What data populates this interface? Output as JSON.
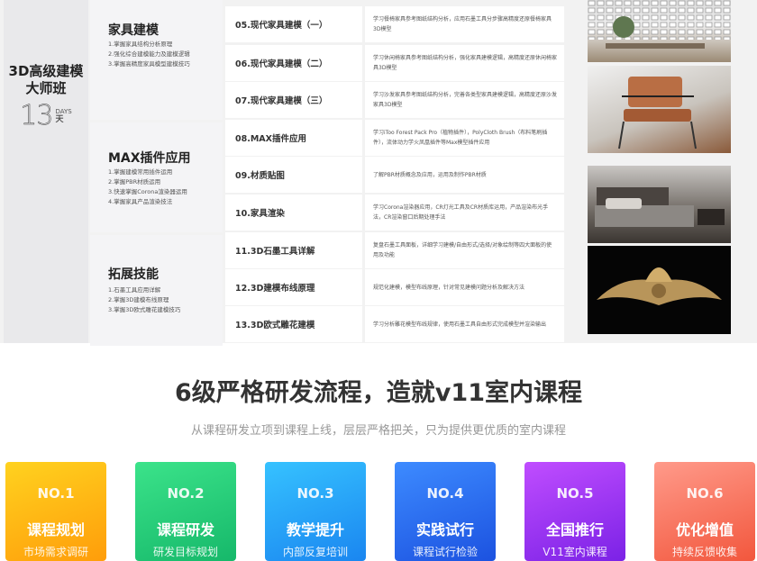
{
  "course": {
    "title_line1": "3D高级建模",
    "title_line2": "大师班",
    "days_number": "13",
    "days_unit_small": "DAYS",
    "days_unit": "天"
  },
  "modules": [
    {
      "title": "家具建模",
      "points": [
        "1.掌握家具结构分析原理",
        "2.强化综合建模能力及建模逻辑",
        "3.掌握高精度家具模型建模技巧"
      ]
    },
    {
      "title": "MAX插件应用",
      "points": [
        "1.掌握建模常用插件运用",
        "2.掌握PBR材质运用",
        "3.快速掌握Corona渲染器运用",
        "4.掌握家具产品渲染技法"
      ]
    },
    {
      "title": "拓展技能",
      "points": [
        "1.石墨工具应用详解",
        "2.掌握3D建模布线原理",
        "3.掌握3D欧式雕花建模技巧"
      ]
    }
  ],
  "lessons": [
    {
      "name": "05.现代家具建模（一）",
      "desc": "学习餐椅家具参考图纸结构分析，应用石墨工具分步骤高精度还原餐椅家具3D模型"
    },
    {
      "name": "06.现代家具建模（二）",
      "desc": "学习休闲椅家具参考图纸结构分析，强化家具建模逻辑，高精度还原休闲椅家具3D模型"
    },
    {
      "name": "07.现代家具建模（三）",
      "desc": "学习沙发家具参考图纸结构分析，完善各类型家具建模逻辑，高精度还原沙发家具3D模型"
    },
    {
      "name": "08.MAX插件应用",
      "desc": "学习iToo Forest Pack Pro（植物插件），PolyCloth Brush（布料笔刷插件），流体动力学火凤凰插件等Max模型插件应用"
    },
    {
      "name": "09.材质贴图",
      "desc": "了解PBR材质概念及应用，运用及制作PBR材质"
    },
    {
      "name": "10.家具渲染",
      "desc": "学习Corona渲染器应用，CR灯光工具及CR材质库运用，产品渲染布光手法，CR渲染窗口后期处理手法"
    },
    {
      "name": "11.3D石墨工具详解",
      "desc": "复盘石墨工具面板，详细学习建模/自由形式/选择/对象绘制等四大面板的使用及功能"
    },
    {
      "name": "12.3D建模布线原理",
      "desc": "规范化建模，模型布线原理，针对常见建模问题分析及解决方法"
    },
    {
      "name": "13.3D欧式雕花建模",
      "desc": "学习分析雕花模型布线规律，使用石墨工具自由形式完成模型并渲染输出"
    }
  ],
  "section": {
    "title": "6级严格研发流程，造就v11室内课程",
    "subtitle": "从课程研发立项到课程上线，层层严格把关，只为提供更优质的室内课程"
  },
  "steps": [
    {
      "no": "NO.1",
      "name": "课程规划",
      "line": "市场需求调研",
      "color_a": "#ffd21f",
      "color_b": "#ff9d0a"
    },
    {
      "no": "NO.2",
      "name": "课程研发",
      "line": "研发目标规划",
      "color_a": "#3be38a",
      "color_b": "#16b86a"
    },
    {
      "no": "NO.3",
      "name": "教学提升",
      "line": "内部反复培训",
      "color_a": "#36c2ff",
      "color_b": "#1a86f0"
    },
    {
      "no": "NO.4",
      "name": "实践试行",
      "line": "课程试行检验",
      "color_a": "#3d8bff",
      "color_b": "#1c52e0"
    },
    {
      "no": "NO.5",
      "name": "全国推行",
      "line": "V11室内课程",
      "color_a": "#c04dff",
      "color_b": "#7b22e6"
    },
    {
      "no": "NO.6",
      "name": "优化增值",
      "line": "持续反馈收集",
      "color_a": "#ff9a8a",
      "color_b": "#f2573d"
    }
  ]
}
